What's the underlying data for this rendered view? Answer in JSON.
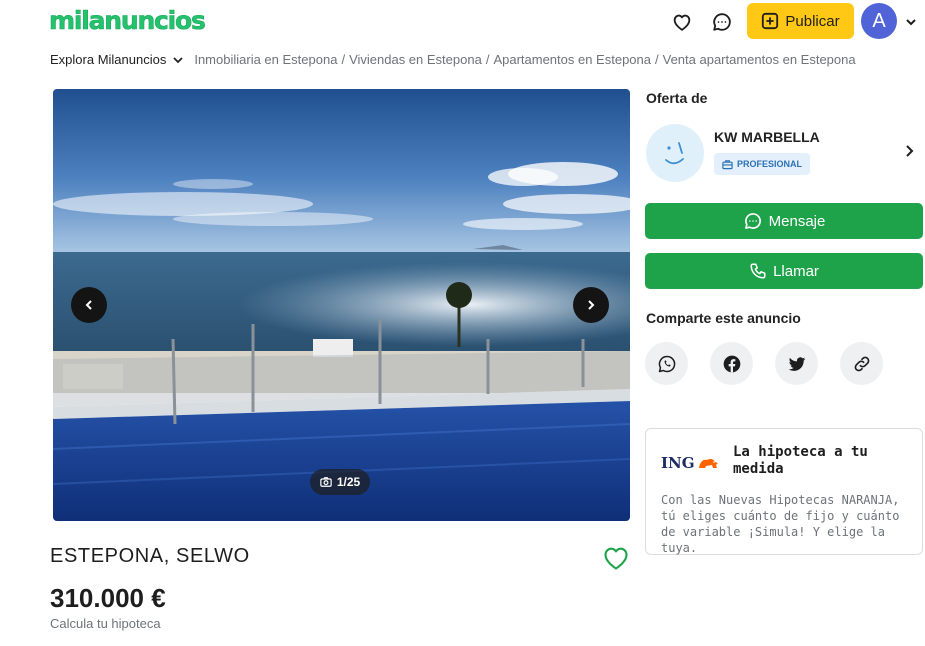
{
  "header": {
    "logo": "milanuncios",
    "publish_label": "Publicar",
    "avatar_initial": "A",
    "icons": [
      "heart-icon",
      "chat-icon",
      "plus-square-icon",
      "chevron-down-icon"
    ]
  },
  "breadcrumb": {
    "explore_label": "Explora Milanuncios",
    "items": [
      "Inmobiliaria en Estepona",
      "Viviendas en Estepona",
      "Apartamentos en Estepona",
      "Venta apartamentos en Estepona"
    ]
  },
  "gallery": {
    "counter": "1/25",
    "icons": [
      "camera-icon",
      "chevron-left-icon",
      "chevron-right-icon"
    ]
  },
  "listing": {
    "title": "ESTEPONA, SELWO",
    "price": "310.000 €",
    "mortgage_link": "Calcula tu hipoteca"
  },
  "seller": {
    "section_title": "Oferta de",
    "name": "KW MARBELLA",
    "badge": "PROFESIONAL",
    "message_label": "Mensaje",
    "call_label": "Llamar"
  },
  "share": {
    "title": "Comparte este anuncio",
    "networks": [
      "whatsapp-icon",
      "facebook-icon",
      "twitter-icon",
      "link-icon"
    ]
  },
  "ad": {
    "brand": "ING",
    "title": "La hipoteca a tu medida",
    "body": "Con las Nuevas Hipotecas NARANJA, tú eliges cuánto de fijo y cuánto de variable ¡Simula! Y elige la tuya."
  },
  "colors": {
    "brand_green": "#25c26e",
    "button_green": "#1fa34a",
    "publish_yellow": "#ffc814",
    "avatar_blue": "#5064d7",
    "ing_orange": "#ff6200"
  }
}
